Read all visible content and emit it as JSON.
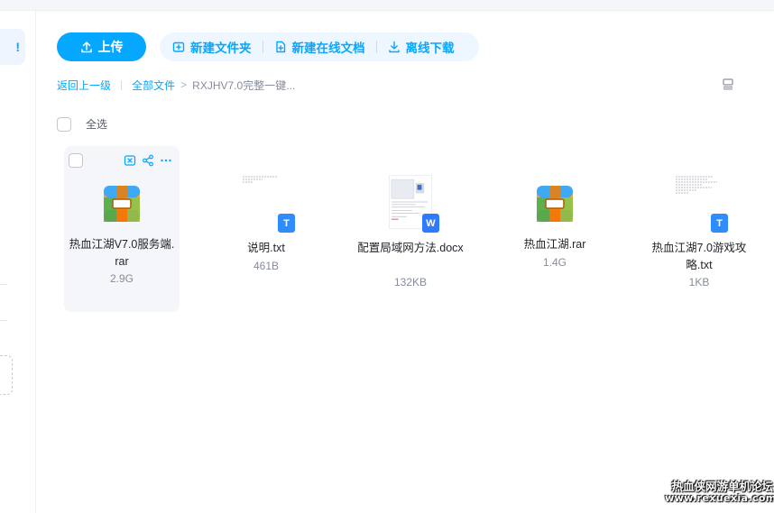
{
  "sidebar": {
    "active_marker": "!"
  },
  "toolbar": {
    "upload_label": "上传",
    "new_folder_label": "新建文件夹",
    "new_online_doc_label": "新建在线文档",
    "offline_download_label": "离线下载"
  },
  "breadcrumb": {
    "back_label": "返回上一级",
    "all_files_label": "全部文件",
    "separator": ">",
    "current_label": "RXJHV7.0完整一键..."
  },
  "select_all_label": "全选",
  "files": [
    {
      "name": "热血江湖V7.0服务端.rar",
      "size": "2.9G",
      "type": "rar"
    },
    {
      "name": "说明.txt",
      "size": "461B",
      "type": "txt",
      "badge": "T"
    },
    {
      "name": "配置局域网方法.docx",
      "size": "132KB",
      "type": "docx",
      "badge": "W"
    },
    {
      "name": "热血江湖.rar",
      "size": "1.4G",
      "type": "rar"
    },
    {
      "name": "热血江湖7.0游戏攻略.txt",
      "size": "1KB",
      "type": "txt",
      "badge": "T"
    }
  ],
  "watermark": {
    "line1": "热血侠网游单机论坛",
    "line2": "www.rexuexia.com"
  },
  "colors": {
    "accent": "#06a7ff",
    "word_badge": "#2f7bff"
  },
  "icons": [
    "upload-icon",
    "new-folder-icon",
    "new-doc-icon",
    "download-icon",
    "list-view-icon",
    "share-icon",
    "link-icon",
    "more-icon"
  ]
}
